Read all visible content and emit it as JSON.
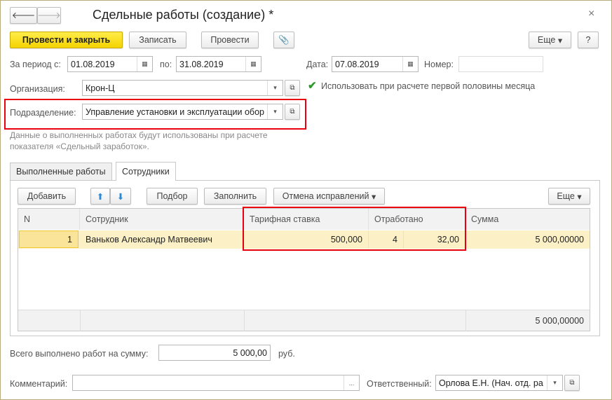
{
  "window": {
    "title": "Сдельные работы (создание) *",
    "close": "×"
  },
  "nav": {
    "back": "🡐",
    "forward": "🡒"
  },
  "toolbar": {
    "post_close": "Провести и закрыть",
    "save": "Записать",
    "post": "Провести",
    "more": "Еще",
    "help": "?"
  },
  "form": {
    "period_from_label": "За период с:",
    "period_from": "01.08.2019",
    "period_to_label": "по:",
    "period_to": "31.08.2019",
    "date_label": "Дата:",
    "date": "07.08.2019",
    "number_label": "Номер:",
    "number": "",
    "org_label": "Организация:",
    "org": "Крон-Ц",
    "first_half_label": "Использовать при расчете первой половины месяца",
    "first_half_checked": true,
    "dept_label": "Подразделение:",
    "dept": "Управление установки и эксплуатации обор",
    "note": "Данные о выполненных работах будут использованы при расчете показателя «Сдельный заработок»."
  },
  "tabs": [
    {
      "label": "Выполненные работы",
      "active": false
    },
    {
      "label": "Сотрудники",
      "active": true
    }
  ],
  "table_toolbar": {
    "add": "Добавить",
    "pick": "Подбор",
    "fill": "Заполнить",
    "cancel_fix": "Отмена исправлений",
    "more": "Еще"
  },
  "table": {
    "columns": [
      "N",
      "Сотрудник",
      "Тарифная ставка",
      "Отработано",
      "Сумма"
    ],
    "rows": [
      {
        "n": "1",
        "employee": "Ваньков Александр Матвеевич",
        "rate": "500,000",
        "worked_days": "4",
        "worked_hours": "32,00",
        "sum": "5 000,00000"
      }
    ],
    "footer_sum": "5 000,00000"
  },
  "total": {
    "label": "Всего выполнено работ на сумму:",
    "value": "5 000,00",
    "currency": "руб."
  },
  "comment": {
    "label": "Комментарий:",
    "value": "",
    "button": "..."
  },
  "responsible": {
    "label": "Ответственный:",
    "value": "Орлова Е.Н. (Нач. отд. ра"
  }
}
